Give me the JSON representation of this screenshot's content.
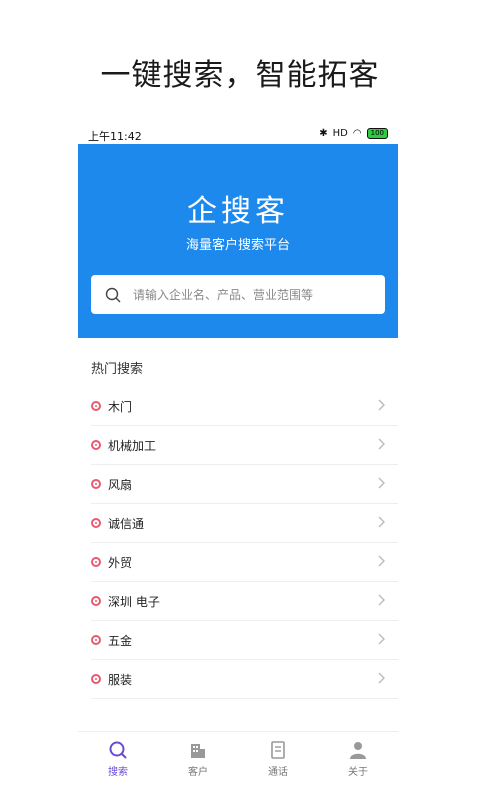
{
  "promo": {
    "headline": "一键搜索，智能拓客"
  },
  "statusbar": {
    "time": "上午11:42",
    "signal": "HD",
    "battery": "100"
  },
  "hero": {
    "title": "企搜客",
    "subtitle": "海量客户搜索平台",
    "search_placeholder": "请输入企业名、产品、营业范围等"
  },
  "hot": {
    "title": "热门搜索",
    "items": [
      {
        "label": "木门"
      },
      {
        "label": "机械加工"
      },
      {
        "label": "风扇"
      },
      {
        "label": "诚信通"
      },
      {
        "label": "外贸"
      },
      {
        "label": "深圳 电子"
      },
      {
        "label": "五金"
      },
      {
        "label": "服装"
      }
    ]
  },
  "tabbar": {
    "tabs": [
      {
        "label": "搜索",
        "icon": "search-icon",
        "active": true
      },
      {
        "label": "客户",
        "icon": "building-icon"
      },
      {
        "label": "通话",
        "icon": "call-record-icon"
      },
      {
        "label": "关于",
        "icon": "person-icon"
      }
    ]
  },
  "colors": {
    "brand": "#1d89ec",
    "active_tab": "#6a4bd6",
    "dot": "#e85a6f"
  }
}
